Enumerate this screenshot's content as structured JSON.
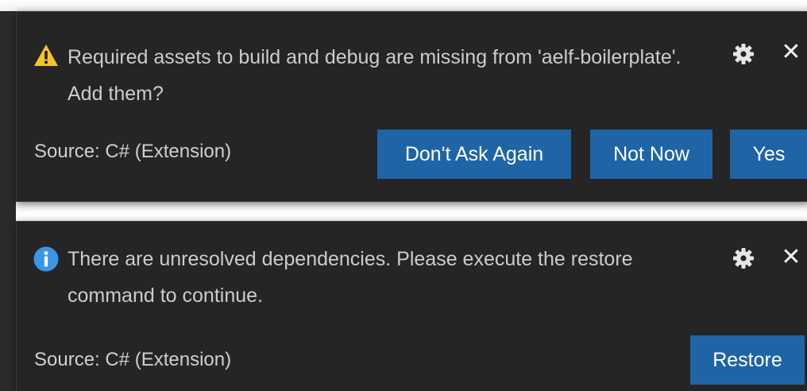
{
  "notifications": [
    {
      "icon": "warning-icon",
      "icon_color": "#f2c52c",
      "message": "Required assets to build and debug are missing from 'aelf-boilerplate'. Add them?",
      "source": "Source: C# (Extension)",
      "actions": {
        "dont_ask_again": "Don't Ask Again",
        "not_now": "Not Now",
        "yes": "Yes"
      }
    },
    {
      "icon": "info-icon",
      "icon_color": "#3a95e8",
      "message": "There are unresolved dependencies. Please execute the restore command to continue.",
      "source": "Source: C# (Extension)",
      "actions": {
        "restore": "Restore"
      }
    }
  ],
  "controls": {
    "settings_icon": "gear-icon",
    "close_icon": "close-icon",
    "close_glyph": "✕"
  },
  "colors": {
    "toast_background": "#252526",
    "button_background": "#1f65a6",
    "text": "#cccccc"
  }
}
